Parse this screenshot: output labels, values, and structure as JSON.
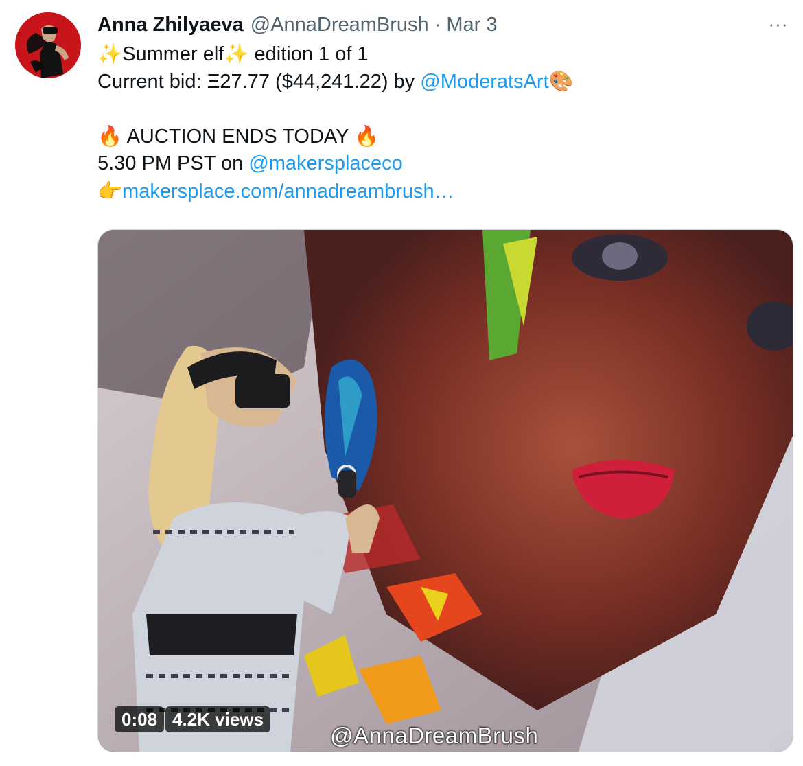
{
  "author": {
    "display_name": "Anna Zhilyaeva",
    "handle": "@AnnaDreamBrush",
    "separator": "·",
    "date": "Mar 3"
  },
  "more_label": "···",
  "tweet": {
    "line1_sparkle_a": "✨",
    "line1_title": "Summer elf",
    "line1_sparkle_b": "✨",
    "line1_edition": " edition 1 of 1",
    "line2_prefix": "Current bid: Ξ27.77 ($44,241.22) by ",
    "line2_mention": "@ModeratsArt",
    "line2_emoji": "🎨",
    "line4_fire_a": "🔥",
    "line4_text": " AUCTION ENDS TODAY ",
    "line4_fire_b": "🔥",
    "line5_prefix": "5.30 PM PST on ",
    "line5_mention": "@makersplaceco",
    "line6_pointer": "👉",
    "line6_link": "makersplace.com/annadreambrush…"
  },
  "media": {
    "duration": "0:08",
    "views": "4.2K views",
    "watermark": "@AnnaDreamBrush"
  },
  "colors": {
    "link": "#1d9bf0",
    "text": "#0f1419",
    "muted": "#536471"
  }
}
